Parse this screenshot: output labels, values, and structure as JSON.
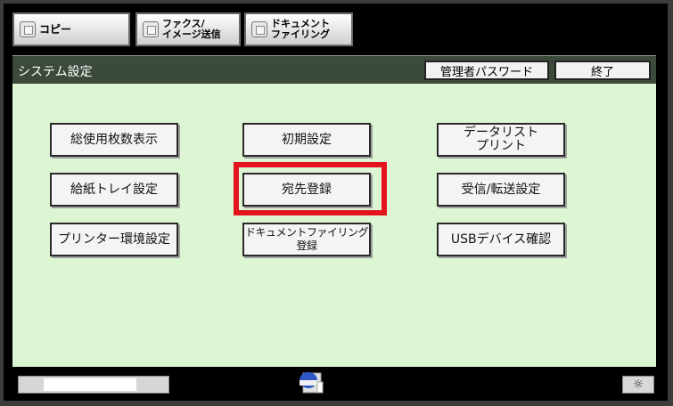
{
  "tabs": [
    {
      "label": "コピー",
      "icon": "copy-icon"
    },
    {
      "label": "ファクス/\nイメージ送信",
      "icon": "fax-icon"
    },
    {
      "label": "ドキュメント\nファイリング",
      "icon": "document-filing-icon"
    }
  ],
  "header": {
    "title": "システム設定",
    "admin_password": "管理者パスワード",
    "end": "終了"
  },
  "buttons": [
    {
      "label": "総使用枚数表示"
    },
    {
      "label": "初期設定"
    },
    {
      "label": "データリスト\nプリント"
    },
    {
      "label": "給紙トレイ設定"
    },
    {
      "label": "宛先登録"
    },
    {
      "label": "受信/転送設定"
    },
    {
      "label": "プリンター環境設定"
    },
    {
      "label": "ドキュメントファイリング登録"
    },
    {
      "label": "USBデバイス確認"
    }
  ],
  "highlight_color": "#e4141e",
  "bottom": {
    "brightness_symbol": "☼",
    "job_icon": "job-status-icon"
  }
}
